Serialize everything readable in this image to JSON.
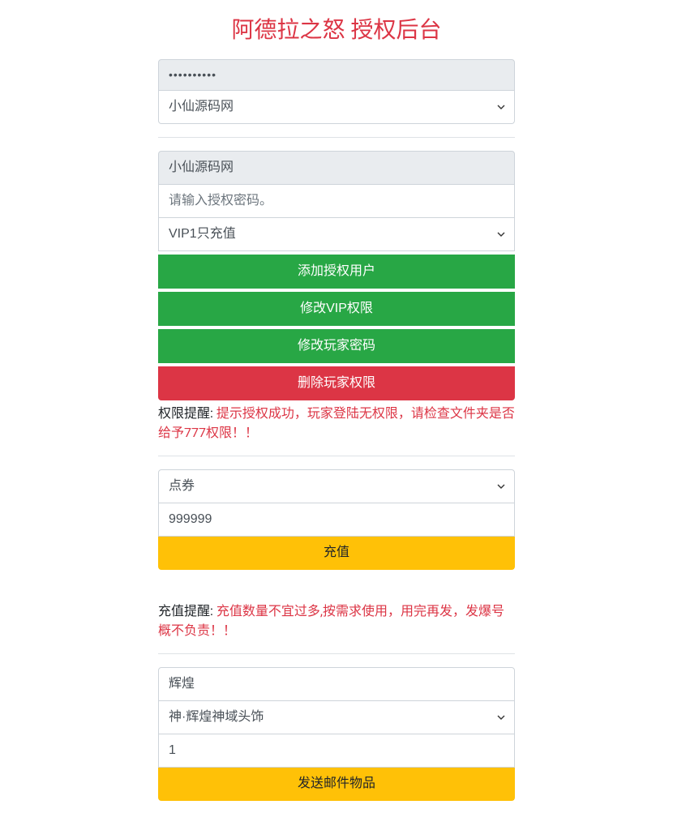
{
  "title": "阿德拉之怒 授权后台",
  "section1": {
    "password_value": "••••••••••",
    "server_select": "小仙源码网"
  },
  "section2": {
    "username_value": "小仙源码网",
    "password_placeholder": "请输入授权密码。",
    "vip_select": "VIP1只充值",
    "btn_add_auth": "添加授权用户",
    "btn_modify_vip": "修改VIP权限",
    "btn_modify_pwd": "修改玩家密码",
    "btn_delete_perm": "删除玩家权限",
    "reminder_label": "权限提醒: ",
    "reminder_text": "提示授权成功，玩家登陆无权限，请检查文件夹是否给予777权限！！"
  },
  "section3": {
    "currency_select": "点券",
    "amount_value": "999999",
    "btn_recharge": "充值",
    "reminder_label": "充值提醒: ",
    "reminder_text": "充值数量不宜过多,按需求使用，用完再发，发爆号概不负责！！"
  },
  "section4": {
    "category_value": "辉煌",
    "item_select": "神·辉煌神域头饰",
    "quantity_value": "1",
    "btn_send_mail": "发送邮件物品"
  }
}
